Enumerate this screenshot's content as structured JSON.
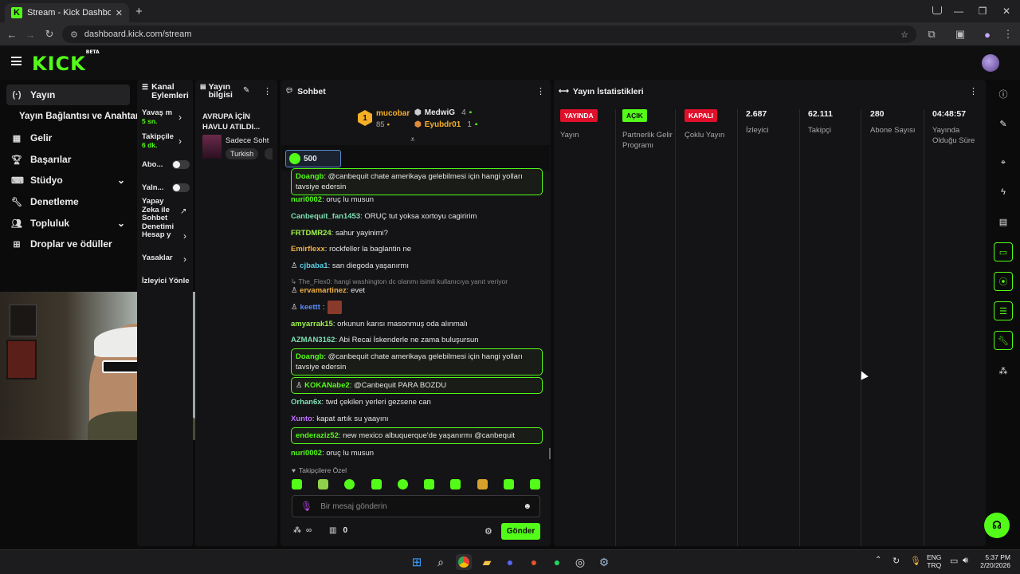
{
  "browser": {
    "tab_title": "Stream - Kick Dashboard",
    "url": "dashboard.kick.com/stream"
  },
  "header": {
    "logo": "KICK",
    "logo_badge": "BETA"
  },
  "nav": {
    "items": [
      {
        "label": "Yayın",
        "icon": "broadcast-icon"
      },
      {
        "label": "Yayın Bağlantısı ve Anahtarı",
        "icon": ""
      },
      {
        "label": "Gelir",
        "icon": "revenue-icon"
      },
      {
        "label": "Başarılar",
        "icon": "trophy-icon"
      },
      {
        "label": "Stüdyo",
        "icon": "studio-icon"
      },
      {
        "label": "Denetleme",
        "icon": "wrench-icon"
      },
      {
        "label": "Topluluk",
        "icon": "community-icon"
      },
      {
        "label": "Droplar ve ödüller",
        "icon": "drops-icon"
      }
    ]
  },
  "channel_actions": {
    "title": "Kanal Eylemleri",
    "slow_mode": "Yavaş m",
    "slow_mode_value": "5 sn.",
    "followers": "Takipçile",
    "followers_value": "6 dk.",
    "abo": "Abo...",
    "yaln": "Yaln...",
    "ai_mod": "Yapay Zeka ile Sohbet Denetimi",
    "account": "Hesap y",
    "bans": "Yasaklar",
    "viewer_dirs": "İzleyici Yönle"
  },
  "stream_info": {
    "title": "Yayın bilgisi",
    "stream_title": "AVRUPA İÇİN HAVLU ATILDI...",
    "category": "Sadece Soht",
    "language": "Turkish"
  },
  "chat": {
    "title": "Sohbet",
    "leader_1": {
      "rank": "1",
      "name": "mucobar",
      "count": "85"
    },
    "leader_2": {
      "name": "MedwiG",
      "count": "4"
    },
    "leader_3": {
      "name": "Eyubdr01",
      "count": "1"
    },
    "pinned_goal": "500",
    "messages": [
      {
        "user": "Doangb",
        "text": "@canbequit chate amerikaya gelebilmesi için hangi yolları tavsiye edersin",
        "color": "#53fc18",
        "hl": true
      },
      {
        "user": "nuri0002",
        "text": "oruç lu musun",
        "color": "#53fc18"
      },
      {
        "user": "Canbequit_fan1453",
        "text": "ORUÇ tut yoksa xortoyu cagiririm",
        "color": "#7ee0b4"
      },
      {
        "user": "FRTDMR24",
        "text": "sahur yayinimi?",
        "color": "#a0f04a"
      },
      {
        "user": "Emirflexx",
        "text": "rockfeller la baglantin ne",
        "color": "#f0b048"
      },
      {
        "user": "cjbaba1",
        "text": "san diegoda yaşanırmı",
        "color": "#5ad1e8"
      },
      {
        "reply": "The_Flex0: hangi washington dc olanmı isimli kullanıcıya yanıt veriyor"
      },
      {
        "user": "ervamartinez",
        "text": "evet",
        "color": "#f0b048"
      },
      {
        "user": "keettt",
        "text": "",
        "color": "#5a8cff"
      },
      {
        "user": "amyarrak15",
        "text": "orkunun karısı masonmuş oda alınmalı",
        "color": "#a0f04a"
      },
      {
        "user": "AZMAN3162",
        "text": "Abi Recai İskenderle ne zama buluşursun",
        "color": "#7ee0b4"
      },
      {
        "user": "Doangb",
        "text": "@canbequit chate amerikaya gelebilmesi için hangi yolları tavsiye edersin",
        "color": "#53fc18",
        "hl": true
      },
      {
        "user": "KOKANabe2",
        "text": "@Canbequit PARA BOZDU",
        "color": "#53fc18",
        "hl": true
      },
      {
        "user": "Orhan6x",
        "text": "twd çekilen yerleri gezsene can",
        "color": "#7ee0b4"
      },
      {
        "user": "Xunto",
        "text": "kapat artık su yaayını",
        "color": "#c070ff"
      },
      {
        "user": "enderaziz52",
        "text": "new mexico albuquerque'de yaşanırmı @canbequit",
        "color": "#53fc18",
        "hl": true
      },
      {
        "user": "nuri0002",
        "text": "oruç lu musun",
        "color": "#53fc18"
      }
    ],
    "emote_header": "Takipçilere Özel",
    "input_placeholder": "Bir mesaj gönderin",
    "points": "0",
    "send_label": "Gönder"
  },
  "stats": {
    "title": "Yayın İstatistikleri",
    "columns": [
      {
        "badge": "YAYINDA",
        "badge_bg": "#e0102a",
        "badge_fg": "#ffffff",
        "label": "Yayın"
      },
      {
        "badge": "AÇIK",
        "badge_bg": "#53fc18",
        "badge_fg": "#0b0b0c",
        "label": "Partnerlik Gelir Programı"
      },
      {
        "badge": "KAPALI",
        "badge_bg": "#e0102a",
        "badge_fg": "#ffffff",
        "label": "Çoklu Yayın"
      },
      {
        "value": "2.687",
        "label": "İzleyici"
      },
      {
        "value": "62.111",
        "label": "Takipçi"
      },
      {
        "value": "280",
        "label": "Abone Sayısı"
      },
      {
        "value": "04:48:57",
        "label": "Yayında Olduğu Süre"
      }
    ]
  },
  "taskbar": {
    "lang": "ENG",
    "region": "TRQ",
    "time": "5:37 PM",
    "date": "2/20/2026"
  },
  "colors": {
    "accent": "#53fc18",
    "live": "#e0102a"
  }
}
